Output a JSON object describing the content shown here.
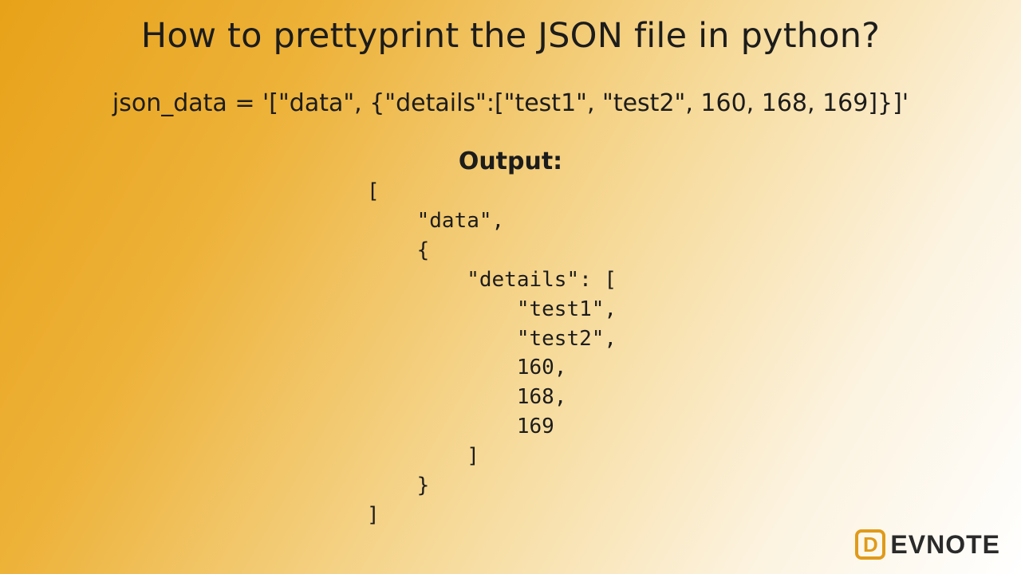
{
  "title": "How to prettyprint the JSON file in python?",
  "code_line": "json_data = '[\"data\", {\"details\":[\"test1\", \"test2\", 160, 168, 169]}]'",
  "output_label": "Output:",
  "output_text": "[\n    \"data\",\n    {\n        \"details\": [\n            \"test1\",\n            \"test2\",\n            160,\n            168,\n            169\n        ]\n    }\n]",
  "logo": {
    "d": "D",
    "rest": "EVNOTE"
  }
}
